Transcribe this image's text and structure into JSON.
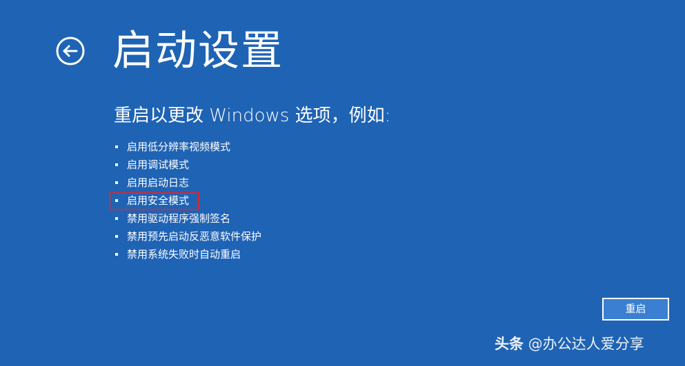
{
  "header": {
    "back_icon": "back-arrow-circle-icon",
    "title": "启动设置"
  },
  "main": {
    "subtitle": "重启以更改 Windows 选项，例如:",
    "options": [
      {
        "label": "启用低分辨率视频模式"
      },
      {
        "label": "启用调试模式"
      },
      {
        "label": "启用启动日志"
      },
      {
        "label": "启用安全模式",
        "highlighted": true
      },
      {
        "label": "禁用驱动程序强制签名"
      },
      {
        "label": "禁用预先启动反恶意软件保护"
      },
      {
        "label": "禁用系统失败时自动重启"
      }
    ]
  },
  "footer": {
    "restart_label": "重启"
  },
  "watermark": {
    "brand": "头条",
    "handle": " @办公达人爱分享"
  },
  "colors": {
    "background": "#1f63b4",
    "highlight_border": "#e0242e",
    "button_fill": "#3a7fd1",
    "text": "#ffffff"
  }
}
